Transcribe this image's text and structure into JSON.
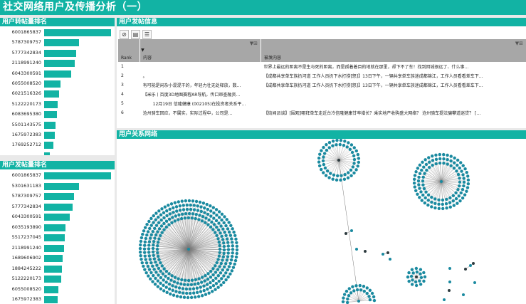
{
  "page_title": "社交网络用户及传播分析（一）",
  "repost_panel": {
    "title": "用户转帖量排名",
    "items": [
      {
        "id": "6001865837",
        "value": 1.0
      },
      {
        "id": "5787309757",
        "value": 0.52
      },
      {
        "id": "5777342834",
        "value": 0.48
      },
      {
        "id": "2118991240",
        "value": 0.46
      },
      {
        "id": "6043300591",
        "value": 0.4
      },
      {
        "id": "6055008520",
        "value": 0.24
      },
      {
        "id": "6021516326",
        "value": 0.22
      },
      {
        "id": "5122220173",
        "value": 0.2
      },
      {
        "id": "6083695380",
        "value": 0.19
      },
      {
        "id": "5501143575",
        "value": 0.17
      },
      {
        "id": "1675972383",
        "value": 0.16
      },
      {
        "id": "1769252712",
        "value": 0.14
      },
      {
        "id": "",
        "value": 0.09
      }
    ]
  },
  "post_count_panel": {
    "title": "用户发帖量排名",
    "items": [
      {
        "id": "6001865837",
        "value": 1.0
      },
      {
        "id": "5301631183",
        "value": 0.52
      },
      {
        "id": "5787309757",
        "value": 0.45
      },
      {
        "id": "5777342834",
        "value": 0.43
      },
      {
        "id": "6043300591",
        "value": 0.38
      },
      {
        "id": "6035193890",
        "value": 0.32
      },
      {
        "id": "5517237045",
        "value": 0.31
      },
      {
        "id": "2118991240",
        "value": 0.3
      },
      {
        "id": "1689606902",
        "value": 0.28
      },
      {
        "id": "1884245222",
        "value": 0.27
      },
      {
        "id": "5122220173",
        "value": 0.25
      },
      {
        "id": "6055008520",
        "value": 0.21
      },
      {
        "id": "1675972383",
        "value": 0.2
      }
    ]
  },
  "post_info_panel": {
    "title": "用户发帖信息",
    "toolbar": [
      {
        "icon": "clear-icon",
        "glyph": "⊘"
      },
      {
        "icon": "export-icon",
        "glyph": "▤"
      },
      {
        "icon": "columns-icon",
        "glyph": "☰"
      }
    ],
    "columns": {
      "rank": "Rank",
      "content": "内容",
      "repost_content": "被发内容"
    },
    "rows": [
      {
        "rank": "1",
        "content": "",
        "repost": "世界上最远的距离不是生与死的距离，而是孤着着目的地就在那里，却下不了车！找到回城很远了、什么事…"
      },
      {
        "rank": "2",
        "content": "。",
        "repost": "【成都共享单车族扔河道 工作人员扔下水打捞[怒]】13日下午，一辆共享单车族迷成都锦江，工作人员看看差车下…"
      },
      {
        "rank": "3",
        "content": "有可能是闲杂小混混干的，年轻力壮无处释放，数…",
        "repost": "【成都共享单车族扔河道 工作人员扔下水打捞[怒]】13日下午，一辆共享单车族迷成都锦江，工作人员看看差车下…"
      },
      {
        "rank": "4",
        "content": "【米乐丨百度3D地图赛程AR导航，传口审查融资…",
        "repost": ""
      },
      {
        "rank": "5",
        "content": "12月19日 信隆健康 (002105)在投资者关系平…",
        "repost": ""
      },
      {
        "rank": "6",
        "content": "沧州骑车回应，不属实，实际过程中，公司是…",
        "repost": "【街闻派谈】[围观]哪拜单车走近台冷信隆健康甘率增长？乘实地产收购盛大网络？ 沧州骑车提法骗攀道迷贷？ […"
      }
    ]
  },
  "network_panel": {
    "title": "用户关系网络"
  },
  "colors": {
    "accent": "#12b3a4",
    "node": "#1a8aa0",
    "node_dark": "#2d3b3f",
    "edge": "#7a7a7a"
  }
}
